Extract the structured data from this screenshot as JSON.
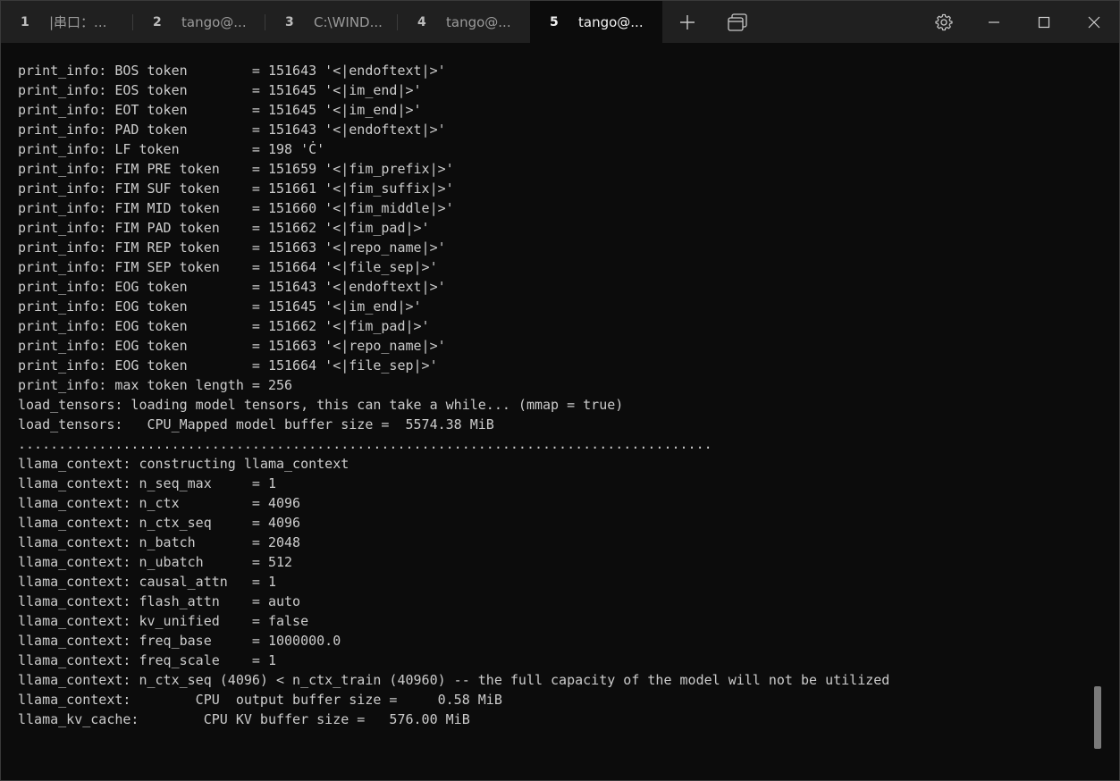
{
  "tabs": [
    {
      "num": "1",
      "title": "|串口：..."
    },
    {
      "num": "2",
      "title": "tango@..."
    },
    {
      "num": "3",
      "title": "C:\\WIND..."
    },
    {
      "num": "4",
      "title": "tango@..."
    },
    {
      "num": "5",
      "title": "tango@..."
    }
  ],
  "active_tab": 4,
  "icons": {
    "new_tab": "plus-icon",
    "tab_overview": "tab-overview-icon",
    "settings": "gear-icon",
    "minimize": "minimize-icon",
    "maximize": "maximize-icon",
    "close": "close-icon"
  },
  "colors": {
    "terminal_bg": "#0c0c0c",
    "titlebar_bg": "#202020",
    "text": "#cccccc"
  },
  "terminal": {
    "lines": [
      "print_info: BOS token        = 151643 '<|endoftext|>'",
      "print_info: EOS token        = 151645 '<|im_end|>'",
      "print_info: EOT token        = 151645 '<|im_end|>'",
      "print_info: PAD token        = 151643 '<|endoftext|>'",
      "print_info: LF token         = 198 'Ċ'",
      "print_info: FIM PRE token    = 151659 '<|fim_prefix|>'",
      "print_info: FIM SUF token    = 151661 '<|fim_suffix|>'",
      "print_info: FIM MID token    = 151660 '<|fim_middle|>'",
      "print_info: FIM PAD token    = 151662 '<|fim_pad|>'",
      "print_info: FIM REP token    = 151663 '<|repo_name|>'",
      "print_info: FIM SEP token    = 151664 '<|file_sep|>'",
      "print_info: EOG token        = 151643 '<|endoftext|>'",
      "print_info: EOG token        = 151645 '<|im_end|>'",
      "print_info: EOG token        = 151662 '<|fim_pad|>'",
      "print_info: EOG token        = 151663 '<|repo_name|>'",
      "print_info: EOG token        = 151664 '<|file_sep|>'",
      "print_info: max token length = 256",
      "load_tensors: loading model tensors, this can take a while... (mmap = true)",
      "load_tensors:   CPU_Mapped model buffer size =  5574.38 MiB",
      "......................................................................................",
      "llama_context: constructing llama_context",
      "llama_context: n_seq_max     = 1",
      "llama_context: n_ctx         = 4096",
      "llama_context: n_ctx_seq     = 4096",
      "llama_context: n_batch       = 2048",
      "llama_context: n_ubatch      = 512",
      "llama_context: causal_attn   = 1",
      "llama_context: flash_attn    = auto",
      "llama_context: kv_unified    = false",
      "llama_context: freq_base     = 1000000.0",
      "llama_context: freq_scale    = 1",
      "llama_context: n_ctx_seq (4096) < n_ctx_train (40960) -- the full capacity of the model will not be utilized",
      "llama_context:        CPU  output buffer size =     0.58 MiB",
      "llama_kv_cache:        CPU KV buffer size =   576.00 MiB"
    ]
  }
}
